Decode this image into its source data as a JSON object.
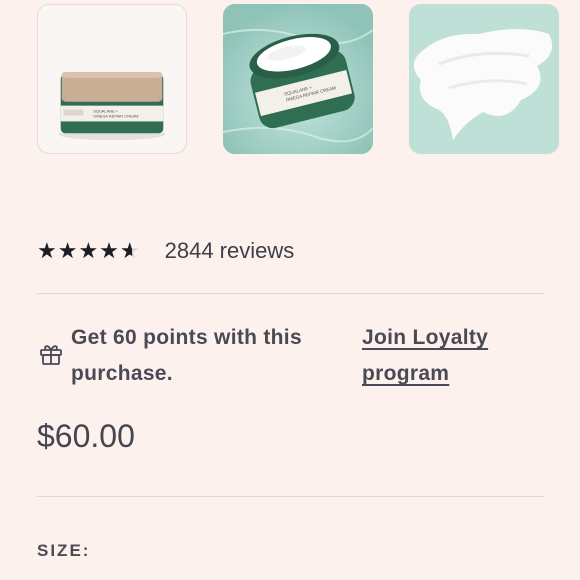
{
  "gallery": {
    "images": [
      {
        "name": "product-jar-front-image"
      },
      {
        "name": "product-jar-open-water-image"
      },
      {
        "name": "cream-texture-image"
      }
    ],
    "jar_label_line1": "SQUALANE +",
    "jar_label_line2": "OMEGA REPAIR CREAM"
  },
  "rating": {
    "stars_text": "★★★★★",
    "value": 4.6,
    "max": 5,
    "reviews_label": "2844 reviews"
  },
  "loyalty": {
    "icon": "gift-icon",
    "points_text": "Get 60 points with this purchase.",
    "link_label": "Join Loyalty program"
  },
  "price": "$60.00",
  "size_label": "SIZE:",
  "colors": {
    "background": "#fdf1ee",
    "text": "#4a4a55",
    "star": "#1d1d25",
    "divider": "#e3d6d3",
    "jar_green": "#2f6e52",
    "jar_lid_gold": "#c9ad94"
  }
}
